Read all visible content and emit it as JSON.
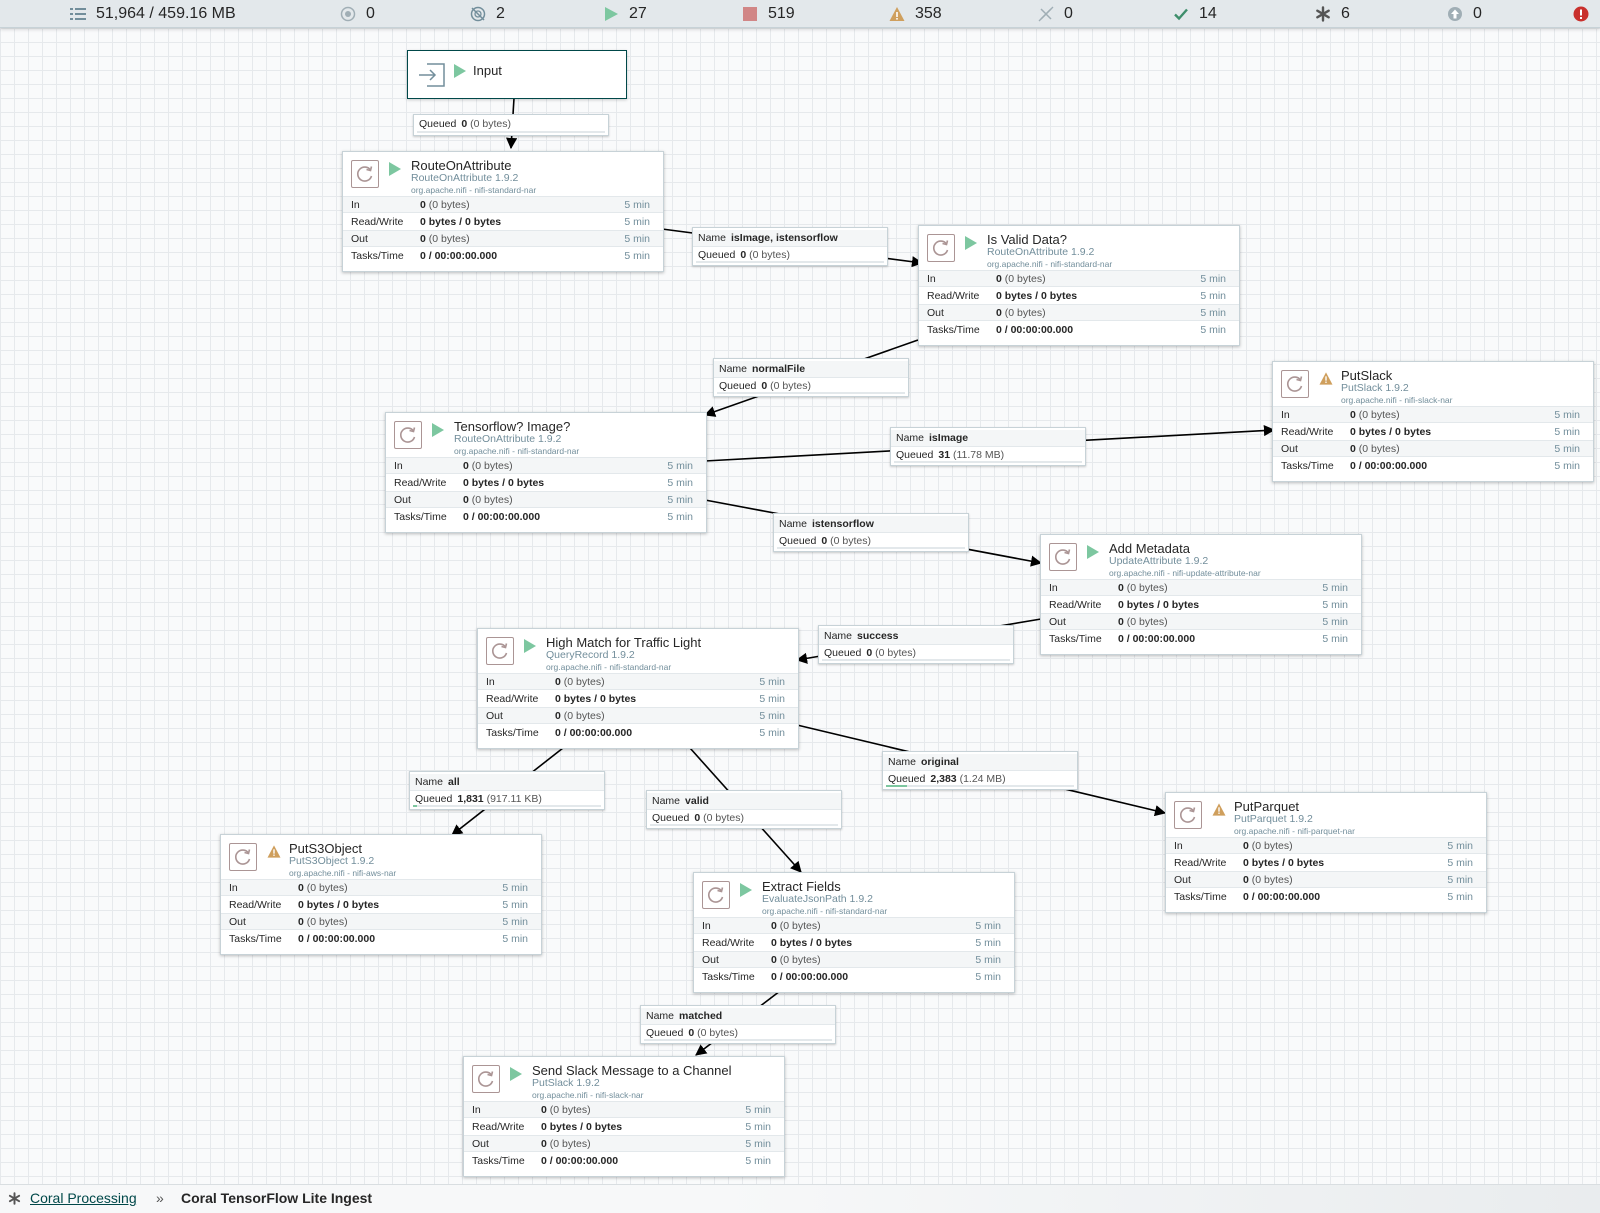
{
  "status_bar": {
    "queued": "51,964 / 459.16 MB",
    "transmitting": "0",
    "not_transmitting": "2",
    "running": "27",
    "stopped": "519",
    "invalid": "358",
    "disabled": "0",
    "up_to_date": "14",
    "locally_modified": "6",
    "sync_failure": "0"
  },
  "input_port": {
    "name": "Input"
  },
  "processors": [
    {
      "name": "RouteOnAttribute",
      "type": "RouteOnAttribute 1.9.2",
      "bundle": "org.apache.nifi - nifi-standard-nar",
      "state": "running",
      "stats": {
        "in": "0",
        "in_sub": "(0 bytes)",
        "rw": "0 bytes / 0 bytes",
        "out": "0",
        "out_sub": "(0 bytes)",
        "tasks": "0 / 00:00:00.000"
      }
    },
    {
      "name": "Is Valid Data?",
      "type": "RouteOnAttribute 1.9.2",
      "bundle": "org.apache.nifi - nifi-standard-nar",
      "state": "running",
      "stats": {
        "in": "0",
        "in_sub": "(0 bytes)",
        "rw": "0 bytes / 0 bytes",
        "out": "0",
        "out_sub": "(0 bytes)",
        "tasks": "0 / 00:00:00.000"
      }
    },
    {
      "name": "PutSlack",
      "type": "PutSlack 1.9.2",
      "bundle": "org.apache.nifi - nifi-slack-nar",
      "state": "invalid",
      "stats": {
        "in": "0",
        "in_sub": "(0 bytes)",
        "rw": "0 bytes / 0 bytes",
        "out": "0",
        "out_sub": "(0 bytes)",
        "tasks": "0 / 00:00:00.000"
      }
    },
    {
      "name": "Tensorflow? Image?",
      "type": "RouteOnAttribute 1.9.2",
      "bundle": "org.apache.nifi - nifi-standard-nar",
      "state": "running",
      "stats": {
        "in": "0",
        "in_sub": "(0 bytes)",
        "rw": "0 bytes / 0 bytes",
        "out": "0",
        "out_sub": "(0 bytes)",
        "tasks": "0 / 00:00:00.000"
      }
    },
    {
      "name": "Add Metadata",
      "type": "UpdateAttribute 1.9.2",
      "bundle": "org.apache.nifi - nifi-update-attribute-nar",
      "state": "running",
      "stats": {
        "in": "0",
        "in_sub": "(0 bytes)",
        "rw": "0 bytes / 0 bytes",
        "out": "0",
        "out_sub": "(0 bytes)",
        "tasks": "0 / 00:00:00.000"
      }
    },
    {
      "name": "High Match for Traffic Light",
      "type": "QueryRecord 1.9.2",
      "bundle": "org.apache.nifi - nifi-standard-nar",
      "state": "running",
      "stats": {
        "in": "0",
        "in_sub": "(0 bytes)",
        "rw": "0 bytes / 0 bytes",
        "out": "0",
        "out_sub": "(0 bytes)",
        "tasks": "0 / 00:00:00.000"
      }
    },
    {
      "name": "PutS3Object",
      "type": "PutS3Object 1.9.2",
      "bundle": "org.apache.nifi - nifi-aws-nar",
      "state": "invalid",
      "stats": {
        "in": "0",
        "in_sub": "(0 bytes)",
        "rw": "0 bytes / 0 bytes",
        "out": "0",
        "out_sub": "(0 bytes)",
        "tasks": "0 / 00:00:00.000"
      }
    },
    {
      "name": "PutParquet",
      "type": "PutParquet 1.9.2",
      "bundle": "org.apache.nifi - nifi-parquet-nar",
      "state": "invalid",
      "stats": {
        "in": "0",
        "in_sub": "(0 bytes)",
        "rw": "0 bytes / 0 bytes",
        "out": "0",
        "out_sub": "(0 bytes)",
        "tasks": "0 / 00:00:00.000"
      }
    },
    {
      "name": "Extract Fields",
      "type": "EvaluateJsonPath 1.9.2",
      "bundle": "org.apache.nifi - nifi-standard-nar",
      "state": "running",
      "stats": {
        "in": "0",
        "in_sub": "(0 bytes)",
        "rw": "0 bytes / 0 bytes",
        "out": "0",
        "out_sub": "(0 bytes)",
        "tasks": "0 / 00:00:00.000"
      }
    },
    {
      "name": "Send Slack Message to a Channel",
      "type": "PutSlack 1.9.2",
      "bundle": "org.apache.nifi - nifi-slack-nar",
      "state": "running",
      "stats": {
        "in": "0",
        "in_sub": "(0 bytes)",
        "rw": "0 bytes / 0 bytes",
        "out": "0",
        "out_sub": "(0 bytes)",
        "tasks": "0 / 00:00:00.000"
      }
    }
  ],
  "row_labels": {
    "in": "In",
    "rw": "Read/Write",
    "out": "Out",
    "tasks": "Tasks/Time",
    "window": "5 min"
  },
  "connection_labels": {
    "name": "Name",
    "queued": "Queued"
  },
  "connections": [
    {
      "name": "",
      "queued": "0",
      "queued_sub": "(0 bytes)",
      "fill": 0
    },
    {
      "name": "isImage, istensorflow",
      "queued": "0",
      "queued_sub": "(0 bytes)",
      "fill": 0
    },
    {
      "name": "normalFile",
      "queued": "0",
      "queued_sub": "(0 bytes)",
      "fill": 0
    },
    {
      "name": "isImage",
      "queued": "31",
      "queued_sub": "(11.78 MB)",
      "fill": 0
    },
    {
      "name": "istensorflow",
      "queued": "0",
      "queued_sub": "(0 bytes)",
      "fill": 0
    },
    {
      "name": "success",
      "queued": "0",
      "queued_sub": "(0 bytes)",
      "fill": 0
    },
    {
      "name": "all",
      "queued": "1,831",
      "queued_sub": "(917.11 KB)",
      "fill": 0.02
    },
    {
      "name": "original",
      "queued": "2,383",
      "queued_sub": "(1.24 MB)",
      "fill": 0.11
    },
    {
      "name": "valid",
      "queued": "0",
      "queued_sub": "(0 bytes)",
      "fill": 0
    },
    {
      "name": "matched",
      "queued": "0",
      "queued_sub": "(0 bytes)",
      "fill": 0
    }
  ],
  "breadcrumbs": {
    "root": "Coral Processing",
    "separator": "»",
    "current": "Coral TensorFlow Lite Ingest"
  },
  "colors": {
    "running": "#7dc7a0",
    "stopped": "#d18686",
    "invalid": "#cf9f5d",
    "accent": "#004849"
  }
}
